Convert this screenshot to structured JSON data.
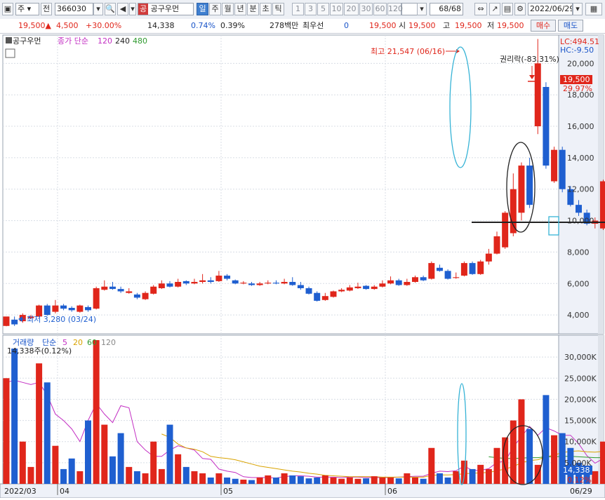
{
  "toolbar": {
    "market": "주",
    "prev_label": "전",
    "code": "366030",
    "stock_badge": "공",
    "stock_name": "공구우먼",
    "periods": [
      "일",
      "주",
      "월",
      "년",
      "분",
      "초",
      "틱"
    ],
    "selected_period": "일",
    "intervals": [
      "1",
      "3",
      "5",
      "10",
      "20",
      "30",
      "60",
      "120"
    ],
    "count": "68",
    "count_total": "/68",
    "date": "2022/06/29"
  },
  "info": {
    "price": "19,500",
    "change": "4,500",
    "change_pct": "+30.00%",
    "volume": "14,338",
    "vol_pct": "0.74%",
    "turnover": "0.39%",
    "amount": "278백만",
    "best_bid_label": "최우선",
    "best_bid": "0",
    "bid_price": "19,500",
    "open_label": "시",
    "open": "19,500",
    "high_label": "고",
    "high": "19,500",
    "low_label": "저",
    "low": "19,500",
    "buy_label": "매수",
    "sell_label": "매도"
  },
  "price_panel": {
    "name": "공구우먼",
    "ma_label": "종가 단순",
    "ma_periods": [
      "120",
      "240",
      "480"
    ],
    "lc": "LC:494.51",
    "hc": "HC:-9.50",
    "current_price": "19,500",
    "current_pct": "29.97%",
    "high_annotation": "최고 21,547 (06/16)",
    "low_annotation": "최저 3,280 (03/24)",
    "rights_annotation": "권리락(-83.31%)",
    "y_ticks": [
      "4,000",
      "6,000",
      "8,000",
      "10,000",
      "12,000",
      "14,000",
      "16,000",
      "18,000",
      "20,000"
    ]
  },
  "volume_panel": {
    "label": "거래량",
    "ma_label": "단순",
    "ma_periods": [
      "5",
      "20",
      "60",
      "120"
    ],
    "current_text": "14,338주(0.12%)",
    "current_value": "14,338",
    "current_pct": "0.12%",
    "y_ticks": [
      "5,000K",
      "10,000K",
      "15,000K",
      "20,000K",
      "25,000K",
      "30,000K"
    ]
  },
  "x_axis": {
    "labels": [
      "2022/03",
      "04",
      "05",
      "06"
    ],
    "end_label": "06/29"
  },
  "colors": {
    "up": "#e0261b",
    "down": "#1f5fd0",
    "ma5": "#c32fc3",
    "ma20": "#d9a300",
    "ma60": "#2f9a2f",
    "highlight_cyan": "#36b3d6"
  },
  "chart_data": {
    "type": "candlestick",
    "y_range": [
      3000,
      21000
    ],
    "volume_range_k": [
      0,
      33000
    ],
    "candles": [
      [
        3300,
        3900,
        3280,
        3700,
        25000
      ],
      [
        3700,
        3400,
        3300,
        3900,
        32000
      ],
      [
        3600,
        4000,
        3500,
        4100,
        10000
      ],
      [
        3800,
        3900,
        3750,
        4000,
        4000
      ],
      [
        3900,
        4600,
        3850,
        4650,
        28500
      ],
      [
        4600,
        4000,
        3950,
        4700,
        24000
      ],
      [
        4200,
        4600,
        4100,
        4950,
        9000
      ],
      [
        4600,
        4400,
        4300,
        4700,
        3500
      ],
      [
        4450,
        4300,
        4200,
        4550,
        6000
      ],
      [
        4200,
        4600,
        4150,
        4650,
        3000
      ],
      [
        4500,
        4300,
        4200,
        4600,
        15000
      ],
      [
        4400,
        5700,
        4350,
        5800,
        34000
      ],
      [
        5600,
        5800,
        5550,
        6200,
        14000
      ],
      [
        5800,
        5650,
        5600,
        6100,
        6500
      ],
      [
        5650,
        5500,
        5400,
        5800,
        12000
      ],
      [
        5400,
        5500,
        5350,
        5700,
        4000
      ],
      [
        5300,
        5100,
        5000,
        5400,
        3000
      ],
      [
        5000,
        5400,
        4950,
        5500,
        2500
      ],
      [
        5350,
        5800,
        5300,
        5900,
        10000
      ],
      [
        5700,
        6000,
        5650,
        6200,
        3500
      ],
      [
        6000,
        5800,
        5750,
        6150,
        14000
      ],
      [
        5800,
        6100,
        5750,
        6300,
        7000
      ],
      [
        6150,
        6000,
        5900,
        6200,
        4000
      ],
      [
        6000,
        6100,
        5950,
        6300,
        3000
      ],
      [
        6100,
        6200,
        6000,
        6600,
        2500
      ],
      [
        6200,
        6100,
        6000,
        6400,
        1500
      ],
      [
        6150,
        6500,
        6100,
        6800,
        2500
      ],
      [
        6500,
        6300,
        6200,
        6600,
        1500
      ],
      [
        6200,
        6000,
        5950,
        6250,
        1200
      ],
      [
        6000,
        6050,
        5950,
        6150,
        1000
      ],
      [
        6000,
        5900,
        5850,
        6100,
        900
      ],
      [
        5900,
        6000,
        5850,
        6100,
        1500
      ],
      [
        6000,
        6050,
        5950,
        6200,
        2000
      ],
      [
        6050,
        6000,
        5950,
        6200,
        1500
      ],
      [
        6000,
        6100,
        5950,
        6300,
        2500
      ],
      [
        6100,
        5900,
        5850,
        6400,
        2000
      ],
      [
        5900,
        5700,
        5600,
        6100,
        1800
      ],
      [
        5700,
        5350,
        5300,
        5800,
        1300
      ],
      [
        5400,
        4900,
        4850,
        5500,
        1500
      ],
      [
        4950,
        5200,
        4900,
        5400,
        2000
      ],
      [
        5150,
        5500,
        5100,
        5550,
        1500
      ],
      [
        5500,
        5600,
        5450,
        5700,
        1200
      ],
      [
        5550,
        5750,
        5500,
        5900,
        1500
      ],
      [
        5700,
        5800,
        5650,
        6050,
        1200
      ],
      [
        5850,
        5650,
        5600,
        5900,
        1300
      ],
      [
        5650,
        5800,
        5600,
        5900,
        1800
      ],
      [
        5800,
        6000,
        5750,
        6200,
        1500
      ],
      [
        6000,
        6200,
        5950,
        6450,
        1500
      ],
      [
        6200,
        5900,
        5850,
        6300,
        1300
      ],
      [
        5900,
        6100,
        5850,
        6300,
        2500
      ],
      [
        6100,
        6400,
        6050,
        6500,
        1500
      ],
      [
        6400,
        6200,
        6150,
        6500,
        1200
      ],
      [
        6300,
        7300,
        6250,
        7400,
        8500
      ],
      [
        7000,
        6800,
        6750,
        7200,
        2500
      ],
      [
        6800,
        6300,
        6250,
        6900,
        1500
      ],
      [
        6350,
        6400,
        6300,
        6700,
        3000
      ],
      [
        6500,
        7300,
        6450,
        7400,
        5500
      ],
      [
        7300,
        6600,
        6550,
        7400,
        3500
      ],
      [
        6600,
        7400,
        6550,
        7500,
        4500
      ],
      [
        7400,
        7900,
        7200,
        8200,
        3500
      ],
      [
        7900,
        9000,
        7850,
        9300,
        8500
      ],
      [
        8300,
        10500,
        8200,
        10600,
        11000
      ],
      [
        9200,
        12000,
        9000,
        13000,
        15000
      ],
      [
        10500,
        13500,
        10000,
        13700,
        20000
      ],
      [
        13500,
        11000,
        10800,
        14000,
        13000
      ],
      [
        16000,
        20000,
        15500,
        21547,
        4500
      ],
      [
        18500,
        13500,
        13300,
        18800,
        21000
      ],
      [
        12500,
        14500,
        12400,
        14700,
        11500
      ],
      [
        14500,
        12000,
        11800,
        14700,
        12000
      ],
      [
        12000,
        11000,
        10900,
        12200,
        8500
      ],
      [
        11000,
        10500,
        10300,
        11300,
        5000
      ],
      [
        10500,
        9800,
        9700,
        10700,
        4000
      ],
      [
        9800,
        10000,
        9500,
        10200,
        3000
      ],
      [
        9500,
        12500,
        9400,
        12600,
        10000
      ],
      [
        12500,
        15000,
        12300,
        15500,
        11500
      ]
    ],
    "ma_volume_5_k": [
      24000,
      24500,
      24000,
      23500,
      24000,
      21000,
      16500,
      15000,
      13000,
      10000,
      15000,
      19000,
      16500,
      14500,
      18500,
      18000,
      10000,
      8000,
      6500,
      6500,
      8000,
      9000,
      8500,
      8000,
      6000,
      5800,
      3500,
      3000,
      2700,
      1700,
      1500,
      1500,
      1500,
      1400,
      1700,
      1900,
      1900,
      1800,
      1600,
      1600,
      1600,
      1500,
      1600,
      1600,
      1500,
      1500,
      1500,
      1500,
      1600,
      1700,
      1800,
      1800,
      2500,
      3000,
      2900,
      3100,
      4200,
      3200,
      3200,
      3600,
      5100,
      5300,
      8700,
      11200,
      13600,
      11500,
      13300,
      12500,
      11500,
      11500,
      9500,
      6700,
      4900,
      6000,
      6700
    ],
    "ma_volume_20_k": [
      null,
      null,
      null,
      null,
      null,
      null,
      null,
      null,
      null,
      null,
      null,
      null,
      null,
      null,
      null,
      null,
      null,
      null,
      null,
      11800,
      11000,
      9400,
      8500,
      8200,
      7600,
      6500,
      6200,
      6000,
      5700,
      5200,
      4700,
      4200,
      3900,
      3600,
      3300,
      3000,
      2800,
      2500,
      2300,
      2000,
      1900,
      1800,
      1700,
      1700,
      1700,
      1700,
      1600,
      1600,
      1600,
      1600,
      1600,
      1600,
      2000,
      2100,
      2100,
      2200,
      2400,
      2500,
      2600,
      2700,
      3100,
      3500,
      4100,
      5000,
      5500,
      5700,
      6400,
      6800,
      7400,
      7700,
      7800,
      7600,
      7500,
      7700,
      7900
    ],
    "ma_volume_60_k": [
      null,
      null,
      null,
      null,
      null,
      null,
      null,
      null,
      null,
      null,
      null,
      null,
      null,
      null,
      null,
      null,
      null,
      null,
      null,
      null,
      null,
      null,
      null,
      null,
      null,
      null,
      null,
      null,
      null,
      null,
      null,
      null,
      null,
      null,
      null,
      null,
      null,
      null,
      null,
      null,
      null,
      null,
      null,
      null,
      null,
      null,
      null,
      null,
      null,
      null,
      null,
      null,
      null,
      null,
      null,
      null,
      null,
      null,
      null,
      6400,
      6200,
      6000,
      6000,
      6100,
      6200,
      6200,
      6400,
      6400,
      6500,
      6500,
      6400,
      6300,
      6200,
      6200,
      6100
    ]
  }
}
